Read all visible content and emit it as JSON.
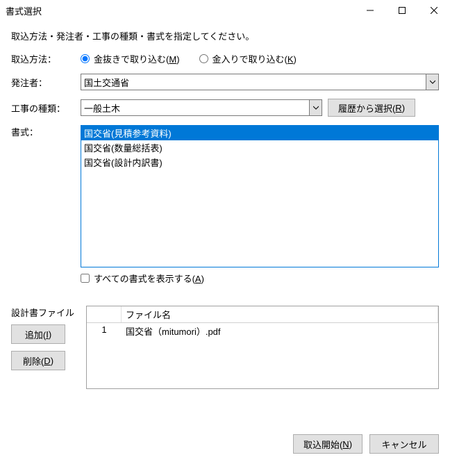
{
  "window": {
    "title": "書式選択"
  },
  "instruction": "取込方法・発注者・工事の種類・書式を指定してください。",
  "labels": {
    "method": "取込方法：",
    "orderer": "発注者：",
    "work_type": "工事の種類：",
    "format": "書式：",
    "design_file": "設計書ファイル"
  },
  "method": {
    "opt1_pre": "金抜きで取り込む(",
    "opt1_key": "M",
    "opt1_post": ")",
    "opt2_pre": "金入りで取り込む(",
    "opt2_key": "K",
    "opt2_post": ")"
  },
  "orderer": {
    "value": "国土交通省"
  },
  "work_type": {
    "value": "一般土木"
  },
  "history_btn": {
    "pre": "履歴から選択(",
    "key": "R",
    "post": ")"
  },
  "format_list": {
    "item0": "国交省(見積参考資料)",
    "item1": "国交省(数量総括表)",
    "item2": "国交省(設計内訳書)"
  },
  "show_all": {
    "pre": "すべての書式を表示する(",
    "key": "A",
    "post": ")"
  },
  "files": {
    "header_name": "ファイル名",
    "row0_num": "1",
    "row0_name": "国交省（mitumori）.pdf"
  },
  "buttons": {
    "add_pre": "追加(",
    "add_key": "I",
    "add_post": ")",
    "del_pre": "削除(",
    "del_key": "D",
    "del_post": ")",
    "start_pre": "取込開始(",
    "start_key": "N",
    "start_post": ")",
    "cancel": "キャンセル"
  }
}
